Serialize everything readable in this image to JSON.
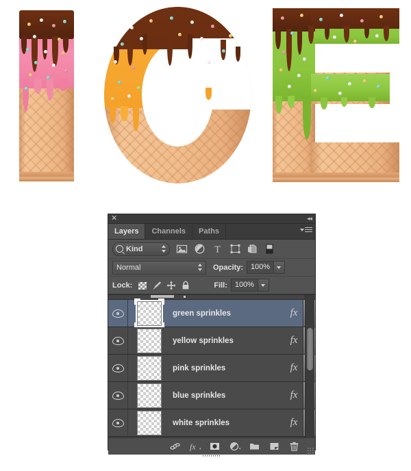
{
  "artwork": {
    "name": "ice-cream-letters-artwork",
    "letters": [
      "I",
      "C",
      "E"
    ],
    "description": "Waffle-textured letters I C E topped with melting icing and sprinkles",
    "glaze_colors": {
      "letter_i": "#f28ba8",
      "letter_c": "#f5a22b",
      "letter_e": "#8cc63e",
      "chocolate": "#5d2810",
      "wafer": "#eab382"
    },
    "sprinkle_colors": [
      "#ffffff",
      "#ffd17a",
      "#8fe0d8",
      "#f0a0a8",
      "#b8e986",
      "#f5a22b"
    ]
  },
  "panel": {
    "close_label": "✕",
    "collapse_label": "◂◂",
    "tabs": [
      {
        "label": "Layers",
        "active": true
      },
      {
        "label": "Channels",
        "active": false
      },
      {
        "label": "Paths",
        "active": false
      }
    ],
    "filter_row": {
      "kind_label": "Kind",
      "icons": [
        "pixel-layer-filter-icon",
        "adjustment-layer-filter-icon",
        "type-layer-filter-icon",
        "shape-layer-filter-icon",
        "smart-object-filter-icon",
        "filter-toggle-switch"
      ]
    },
    "blend_row": {
      "blend_mode": "Normal",
      "opacity_label": "Opacity:",
      "opacity_value": "100%"
    },
    "lock_row": {
      "lock_label": "Lock:",
      "lock_icons": [
        "lock-transparent-pixels-icon",
        "lock-image-pixels-icon",
        "lock-position-icon",
        "lock-all-icon"
      ],
      "fill_label": "Fill:",
      "fill_value": "100%"
    },
    "layers": [
      {
        "name": "green sprinkles",
        "visible": true,
        "selected": true,
        "fx": "fx"
      },
      {
        "name": "yellow sprinkles",
        "visible": true,
        "selected": false,
        "fx": "fx"
      },
      {
        "name": "pink sprinkles",
        "visible": true,
        "selected": false,
        "fx": "fx"
      },
      {
        "name": "blue sprinkles",
        "visible": true,
        "selected": false,
        "fx": "fx"
      },
      {
        "name": "white sprinkles",
        "visible": true,
        "selected": false,
        "fx": "fx"
      }
    ],
    "footer_buttons": [
      "link-layers-icon",
      "add-layer-style-icon",
      "add-layer-mask-icon",
      "new-fill-adjustment-layer-icon",
      "new-group-icon",
      "new-layer-icon",
      "delete-layer-icon"
    ]
  }
}
